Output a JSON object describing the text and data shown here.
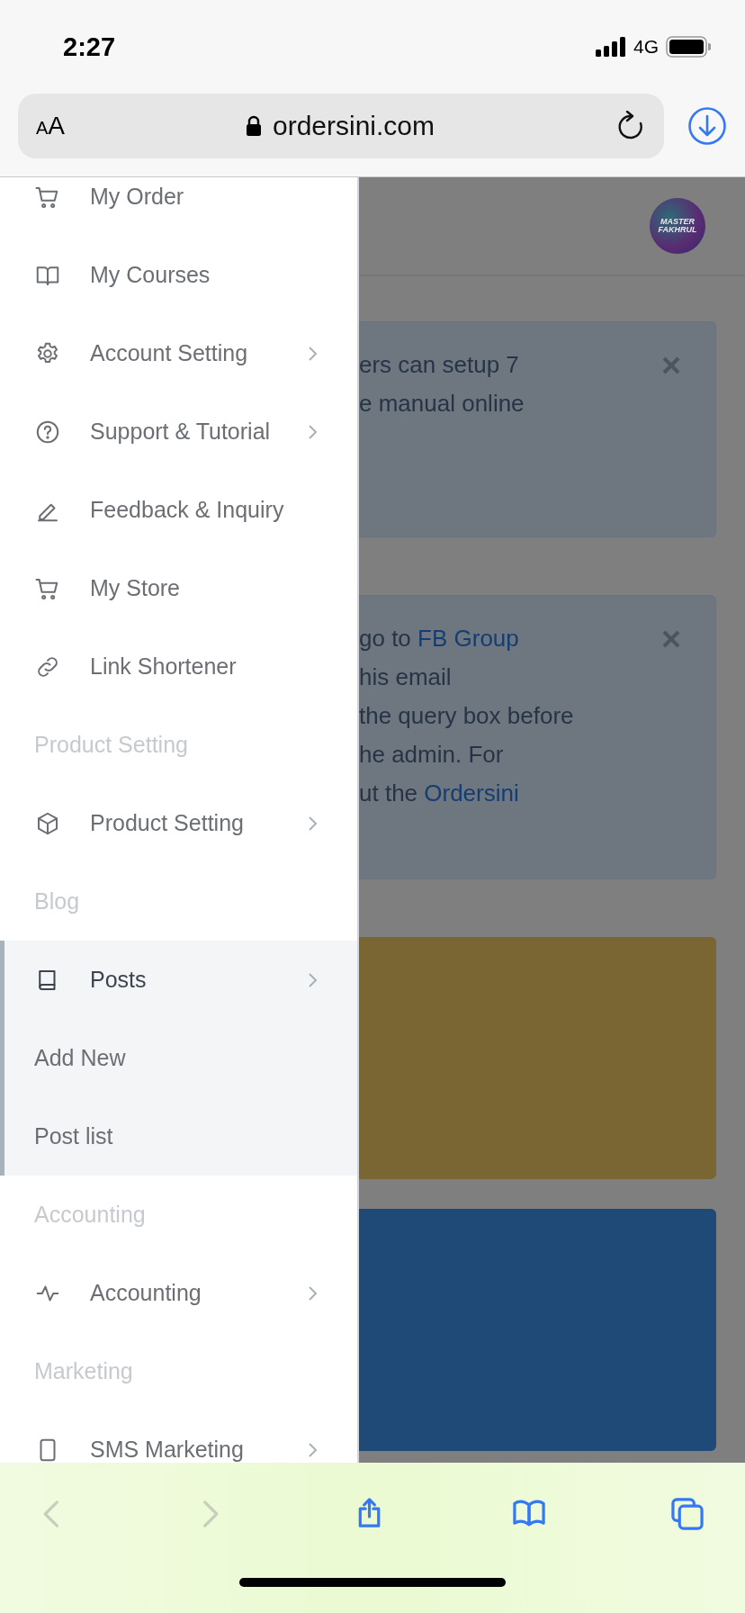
{
  "status_bar": {
    "time": "2:27",
    "network": "4G"
  },
  "browser": {
    "text_size_button": "AA",
    "url": "ordersini.com"
  },
  "menu": [
    {
      "kind": "item",
      "label": "My Order",
      "chevron": false,
      "expanded": false
    },
    {
      "kind": "item",
      "label": "My Courses",
      "chevron": false,
      "expanded": false
    },
    {
      "kind": "item",
      "label": "Account Setting",
      "chevron": true,
      "expanded": false
    },
    {
      "kind": "item",
      "label": "Support & Tutorial",
      "chevron": true,
      "expanded": false
    },
    {
      "kind": "item",
      "label": "Feedback & Inquiry",
      "chevron": false,
      "expanded": false
    },
    {
      "kind": "item",
      "label": "My Store",
      "chevron": false,
      "expanded": false
    },
    {
      "kind": "item",
      "label": "Link Shortener",
      "chevron": false,
      "expanded": false
    },
    {
      "kind": "heading",
      "label": "Product Setting"
    },
    {
      "kind": "item",
      "label": "Product Setting",
      "chevron": true,
      "expanded": false
    },
    {
      "kind": "heading",
      "label": "Blog"
    },
    {
      "kind": "item",
      "label": "Posts",
      "chevron": true,
      "expanded": true,
      "children": [
        {
          "label": "Add New"
        },
        {
          "label": "Post list"
        }
      ]
    },
    {
      "kind": "heading",
      "label": "Accounting"
    },
    {
      "kind": "item",
      "label": "Accounting",
      "chevron": true,
      "expanded": false
    },
    {
      "kind": "heading",
      "label": "Marketing"
    },
    {
      "kind": "item",
      "label": "SMS Marketing",
      "chevron": true,
      "expanded": false
    }
  ],
  "page": {
    "avatar_text": "MASTER FAKHRUL",
    "notices": [
      {
        "closable": true,
        "lines": [
          {
            "text": "ers can setup 7"
          },
          {
            "text": "e manual online"
          }
        ]
      },
      {
        "closable": true,
        "lines": [
          {
            "text": "go to ",
            "link": "FB Group"
          },
          {
            "text": "his email"
          },
          {
            "text": "the query box before"
          },
          {
            "text": "he admin. For"
          },
          {
            "text": "ut the ",
            "link": "Ordersini"
          }
        ]
      }
    ],
    "banners": [
      {
        "color": "#7a6632"
      },
      {
        "color": "#1f4a78"
      }
    ]
  },
  "toolbar": [
    {
      "kind": "back",
      "disabled": true
    },
    {
      "kind": "forward",
      "disabled": true
    },
    {
      "kind": "share",
      "disabled": false
    },
    {
      "kind": "bookmarks",
      "disabled": false
    },
    {
      "kind": "tabs",
      "disabled": false
    }
  ]
}
